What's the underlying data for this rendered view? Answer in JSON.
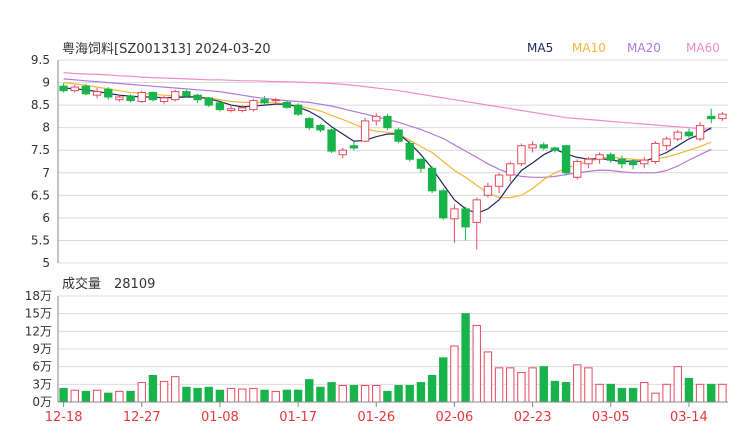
{
  "title": "粤海饲料[SZ001313] 2024-03-20",
  "legend": [
    {
      "label": "MA5",
      "color": "#1e2a5a"
    },
    {
      "label": "MA10",
      "color": "#f2b63a"
    },
    {
      "label": "MA20",
      "color": "#b07ad8"
    },
    {
      "label": "MA60",
      "color": "#f08cc8"
    }
  ],
  "colors": {
    "up": "#e84a5f",
    "down": "#18b34a",
    "grid": "#dcdcdc",
    "axis": "#666666",
    "date": "#e8383d"
  },
  "volume": {
    "label": "成交量",
    "value": "28109"
  },
  "chart_data": [
    {
      "type": "candlestick",
      "title": "粤海饲料[SZ001313] 2024-03-20",
      "ylim": [
        5,
        9.5
      ],
      "yticks": [
        "9.5",
        "9",
        "8.5",
        "8",
        "7.5",
        "7",
        "6.5",
        "6",
        "5.5",
        "5"
      ],
      "x_tick_labels": [
        "12-18",
        "12-27",
        "01-08",
        "01-17",
        "01-26",
        "02-06",
        "02-23",
        "03-05",
        "03-14"
      ],
      "x_tick_index": [
        0,
        7,
        14,
        21,
        28,
        35,
        42,
        49,
        56
      ],
      "candles": [
        {
          "o": 8.92,
          "c": 8.82,
          "h": 8.98,
          "l": 8.78
        },
        {
          "o": 8.82,
          "c": 8.9,
          "h": 8.95,
          "l": 8.78
        },
        {
          "o": 8.92,
          "c": 8.75,
          "h": 8.97,
          "l": 8.72
        },
        {
          "o": 8.72,
          "c": 8.8,
          "h": 8.88,
          "l": 8.65
        },
        {
          "o": 8.85,
          "c": 8.68,
          "h": 8.9,
          "l": 8.62
        },
        {
          "o": 8.62,
          "c": 8.68,
          "h": 8.72,
          "l": 8.58
        },
        {
          "o": 8.7,
          "c": 8.6,
          "h": 8.74,
          "l": 8.56
        },
        {
          "o": 8.58,
          "c": 8.78,
          "h": 8.82,
          "l": 8.55
        },
        {
          "o": 8.78,
          "c": 8.62,
          "h": 8.8,
          "l": 8.58
        },
        {
          "o": 8.58,
          "c": 8.66,
          "h": 8.7,
          "l": 8.52
        },
        {
          "o": 8.62,
          "c": 8.8,
          "h": 8.84,
          "l": 8.58
        },
        {
          "o": 8.8,
          "c": 8.7,
          "h": 8.84,
          "l": 8.66
        },
        {
          "o": 8.72,
          "c": 8.62,
          "h": 8.75,
          "l": 8.55
        },
        {
          "o": 8.66,
          "c": 8.5,
          "h": 8.68,
          "l": 8.46
        },
        {
          "o": 8.55,
          "c": 8.4,
          "h": 8.58,
          "l": 8.36
        },
        {
          "o": 8.38,
          "c": 8.42,
          "h": 8.48,
          "l": 8.34
        },
        {
          "o": 8.38,
          "c": 8.44,
          "h": 8.5,
          "l": 8.34
        },
        {
          "o": 8.4,
          "c": 8.6,
          "h": 8.64,
          "l": 8.36
        },
        {
          "o": 8.62,
          "c": 8.55,
          "h": 8.7,
          "l": 8.5
        },
        {
          "o": 8.6,
          "c": 8.62,
          "h": 8.66,
          "l": 8.52
        },
        {
          "o": 8.56,
          "c": 8.45,
          "h": 8.6,
          "l": 8.42
        },
        {
          "o": 8.5,
          "c": 8.3,
          "h": 8.54,
          "l": 8.26
        },
        {
          "o": 8.2,
          "c": 8.0,
          "h": 8.24,
          "l": 7.95
        },
        {
          "o": 8.05,
          "c": 7.95,
          "h": 8.08,
          "l": 7.9
        },
        {
          "o": 7.95,
          "c": 7.48,
          "h": 7.98,
          "l": 7.44
        },
        {
          "o": 7.4,
          "c": 7.5,
          "h": 7.55,
          "l": 7.32
        },
        {
          "o": 7.6,
          "c": 7.55,
          "h": 7.7,
          "l": 7.5
        },
        {
          "o": 7.7,
          "c": 8.15,
          "h": 8.22,
          "l": 7.68
        },
        {
          "o": 8.15,
          "c": 8.25,
          "h": 8.32,
          "l": 8.05
        },
        {
          "o": 8.25,
          "c": 8.0,
          "h": 8.3,
          "l": 7.95
        },
        {
          "o": 7.95,
          "c": 7.7,
          "h": 8.0,
          "l": 7.65
        },
        {
          "o": 7.65,
          "c": 7.3,
          "h": 7.7,
          "l": 7.25
        },
        {
          "o": 7.3,
          "c": 7.1,
          "h": 7.32,
          "l": 7.0
        },
        {
          "o": 7.1,
          "c": 6.6,
          "h": 7.15,
          "l": 6.55
        },
        {
          "o": 6.6,
          "c": 6.0,
          "h": 6.65,
          "l": 5.95
        },
        {
          "o": 5.98,
          "c": 6.2,
          "h": 6.3,
          "l": 5.45
        },
        {
          "o": 6.2,
          "c": 5.8,
          "h": 6.25,
          "l": 5.5
        },
        {
          "o": 5.9,
          "c": 6.4,
          "h": 6.45,
          "l": 5.3
        },
        {
          "o": 6.5,
          "c": 6.7,
          "h": 6.78,
          "l": 6.45
        },
        {
          "o": 6.7,
          "c": 6.95,
          "h": 7.0,
          "l": 6.55
        },
        {
          "o": 6.95,
          "c": 7.2,
          "h": 7.25,
          "l": 6.8
        },
        {
          "o": 7.2,
          "c": 7.6,
          "h": 7.65,
          "l": 7.15
        },
        {
          "o": 7.55,
          "c": 7.62,
          "h": 7.7,
          "l": 7.45
        },
        {
          "o": 7.62,
          "c": 7.55,
          "h": 7.68,
          "l": 7.5
        },
        {
          "o": 7.55,
          "c": 7.5,
          "h": 7.58,
          "l": 7.45
        },
        {
          "o": 7.6,
          "c": 7.0,
          "h": 7.62,
          "l": 6.95
        },
        {
          "o": 6.9,
          "c": 7.25,
          "h": 7.3,
          "l": 6.85
        },
        {
          "o": 7.2,
          "c": 7.3,
          "h": 7.35,
          "l": 7.1
        },
        {
          "o": 7.3,
          "c": 7.4,
          "h": 7.45,
          "l": 7.2
        },
        {
          "o": 7.4,
          "c": 7.28,
          "h": 7.45,
          "l": 7.22
        },
        {
          "o": 7.3,
          "c": 7.2,
          "h": 7.38,
          "l": 7.1
        },
        {
          "o": 7.25,
          "c": 7.18,
          "h": 7.3,
          "l": 7.08
        },
        {
          "o": 7.2,
          "c": 7.28,
          "h": 7.35,
          "l": 7.1
        },
        {
          "o": 7.25,
          "c": 7.65,
          "h": 7.7,
          "l": 7.2
        },
        {
          "o": 7.6,
          "c": 7.75,
          "h": 7.8,
          "l": 7.5
        },
        {
          "o": 7.75,
          "c": 7.9,
          "h": 7.95,
          "l": 7.7
        },
        {
          "o": 7.9,
          "c": 7.82,
          "h": 7.98,
          "l": 7.78
        },
        {
          "o": 7.75,
          "c": 8.05,
          "h": 8.12,
          "l": 7.7
        },
        {
          "o": 8.25,
          "c": 8.2,
          "h": 8.42,
          "l": 8.1
        },
        {
          "o": 8.2,
          "c": 8.3,
          "h": 8.35,
          "l": 8.15
        }
      ],
      "series": [
        {
          "name": "MA5",
          "color": "#1e2a5a",
          "values": [
            8.88,
            8.86,
            8.84,
            8.8,
            8.76,
            8.72,
            8.7,
            8.68,
            8.68,
            8.66,
            8.67,
            8.68,
            8.68,
            8.64,
            8.58,
            8.5,
            8.46,
            8.48,
            8.5,
            8.52,
            8.52,
            8.46,
            8.36,
            8.22,
            8.02,
            7.86,
            7.7,
            7.72,
            7.8,
            7.86,
            7.86,
            7.66,
            7.4,
            7.1,
            6.74,
            6.4,
            6.2,
            6.1,
            6.2,
            6.4,
            6.75,
            7.05,
            7.22,
            7.4,
            7.52,
            7.42,
            7.34,
            7.3,
            7.32,
            7.28,
            7.25,
            7.26,
            7.25,
            7.35,
            7.45,
            7.6,
            7.75,
            7.85,
            8.0
          ]
        },
        {
          "name": "MA10",
          "color": "#f2b63a",
          "values": [
            9.0,
            8.97,
            8.94,
            8.9,
            8.86,
            8.82,
            8.78,
            8.76,
            8.74,
            8.72,
            8.7,
            8.69,
            8.68,
            8.66,
            8.62,
            8.58,
            8.56,
            8.56,
            8.56,
            8.55,
            8.52,
            8.48,
            8.43,
            8.37,
            8.27,
            8.18,
            8.08,
            7.98,
            7.92,
            7.9,
            7.86,
            7.72,
            7.58,
            7.45,
            7.25,
            7.05,
            6.9,
            6.72,
            6.55,
            6.45,
            6.45,
            6.5,
            6.65,
            6.85,
            7.0,
            7.1,
            7.18,
            7.25,
            7.32,
            7.35,
            7.32,
            7.3,
            7.28,
            7.3,
            7.35,
            7.42,
            7.5,
            7.58,
            7.68
          ]
        },
        {
          "name": "MA20",
          "color": "#b07ad8",
          "values": [
            9.08,
            9.06,
            9.04,
            9.02,
            9.0,
            8.98,
            8.96,
            8.94,
            8.92,
            8.9,
            8.88,
            8.86,
            8.84,
            8.82,
            8.8,
            8.76,
            8.72,
            8.68,
            8.65,
            8.62,
            8.6,
            8.58,
            8.56,
            8.52,
            8.48,
            8.42,
            8.36,
            8.3,
            8.24,
            8.18,
            8.12,
            8.04,
            7.96,
            7.86,
            7.76,
            7.62,
            7.48,
            7.34,
            7.2,
            7.08,
            6.98,
            6.92,
            6.9,
            6.9,
            6.92,
            6.96,
            7.0,
            7.03,
            7.06,
            7.05,
            7.02,
            7.0,
            7.0,
            7.0,
            7.05,
            7.15,
            7.28,
            7.4,
            7.52
          ]
        },
        {
          "name": "MA60",
          "color": "#f08cc8",
          "values": [
            9.22,
            9.2,
            9.19,
            9.18,
            9.17,
            9.15,
            9.14,
            9.12,
            9.11,
            9.1,
            9.09,
            9.08,
            9.07,
            9.06,
            9.06,
            9.05,
            9.04,
            9.04,
            9.03,
            9.02,
            9.02,
            9.01,
            9.0,
            8.99,
            8.98,
            8.96,
            8.94,
            8.91,
            8.88,
            8.85,
            8.82,
            8.78,
            8.74,
            8.7,
            8.66,
            8.62,
            8.58,
            8.54,
            8.5,
            8.46,
            8.42,
            8.38,
            8.34,
            8.3,
            8.26,
            8.22,
            8.2,
            8.18,
            8.16,
            8.14,
            8.12,
            8.1,
            8.08,
            8.06,
            8.04,
            8.02,
            8.0,
            7.98,
            7.96
          ]
        }
      ]
    },
    {
      "type": "bar",
      "title": "成交量 28109",
      "ylim": [
        0,
        18
      ],
      "yticks": [
        "18万",
        "15万",
        "12万",
        "9万",
        "6万",
        "3万",
        "0万"
      ],
      "unit": "万",
      "values": [
        2.3,
        2.0,
        1.8,
        2.0,
        1.5,
        1.8,
        1.8,
        3.3,
        4.5,
        3.5,
        4.3,
        2.5,
        2.3,
        2.5,
        2.0,
        2.3,
        2.2,
        2.3,
        2.0,
        1.8,
        2.0,
        2.0,
        3.8,
        2.5,
        3.3,
        2.8,
        2.8,
        2.8,
        2.8,
        1.8,
        2.8,
        2.8,
        3.3,
        4.5,
        7.5,
        9.5,
        15.0,
        13.0,
        8.5,
        5.8,
        5.8,
        5.0,
        5.8,
        6.0,
        3.5,
        3.3,
        6.3,
        5.8,
        3.0,
        3.0,
        2.3,
        2.3,
        3.3,
        1.5,
        3.0,
        6.0,
        4.0,
        3.0,
        3.0,
        3.0
      ]
    }
  ]
}
